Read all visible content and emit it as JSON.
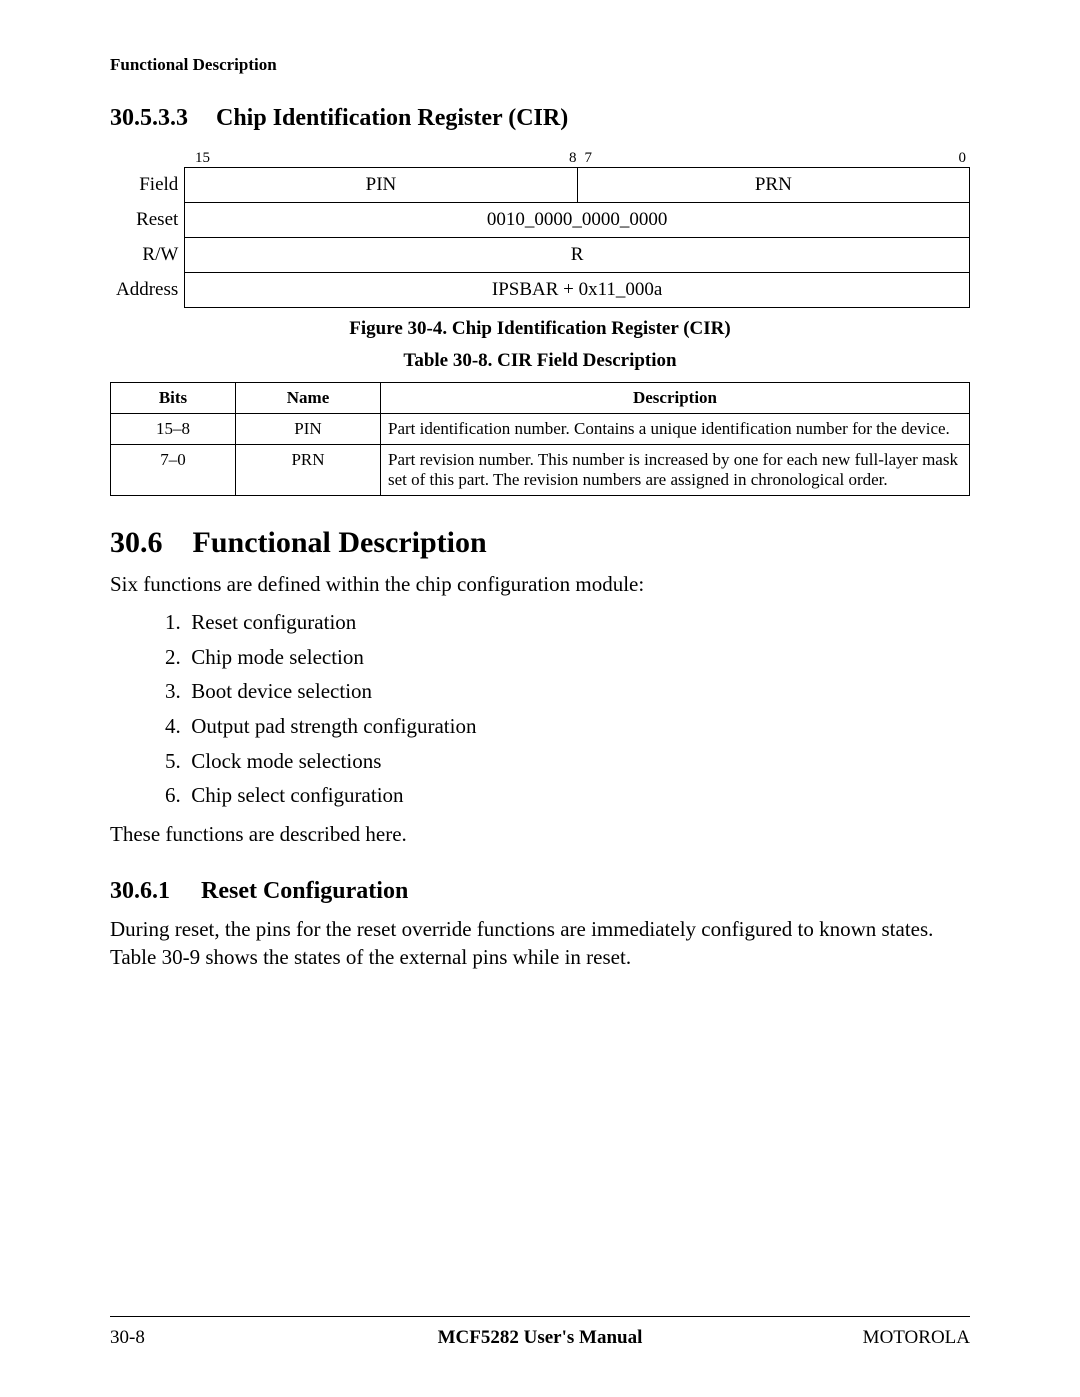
{
  "doc": {
    "running_header": "Functional Description",
    "page_number": "30-8",
    "manual_title": "MCF5282 User's Manual",
    "vendor": "MOTOROLA"
  },
  "s1": {
    "number": "30.5.3.3",
    "title": "Chip Identification Register (CIR)"
  },
  "register": {
    "bit_hi_left": "15",
    "bit_hi_right": "8",
    "bit_lo_left": "7",
    "bit_lo_right": "0",
    "row_labels": {
      "field": "Field",
      "reset": "Reset",
      "rw": "R/W",
      "address": "Address"
    },
    "fields": {
      "hi": "PIN",
      "lo": "PRN"
    },
    "reset_value": "0010_0000_0000_0000",
    "rw_value": "R",
    "address_value": "IPSBAR + 0x11_000a"
  },
  "figure_caption": "Figure 30-4. Chip Identification Register (CIR)",
  "table_caption": "Table 30-8. CIR Field Description",
  "field_table": {
    "headers": {
      "bits": "Bits",
      "name": "Name",
      "desc": "Description"
    },
    "rows": [
      {
        "bits": "15–8",
        "name": "PIN",
        "desc": "Part identification number. Contains a unique identification number for the device."
      },
      {
        "bits": "7–0",
        "name": "PRN",
        "desc": "Part revision number. This number is increased by one for each new full-layer mask set of this part. The revision numbers are assigned in chronological order."
      }
    ]
  },
  "s2": {
    "number": "30.6",
    "title": "Functional Description",
    "intro": "Six functions are defined within the chip configuration module:",
    "list": [
      "Reset configuration",
      "Chip mode selection",
      "Boot device selection",
      "Output pad strength configuration",
      "Clock mode selections",
      "Chip select configuration"
    ],
    "outro": "These functions are described here."
  },
  "s3": {
    "number": "30.6.1",
    "title": "Reset Configuration",
    "para": "During reset, the pins for the reset override functions are immediately configured to known states. Table 30-9 shows the states of the external pins while in reset."
  }
}
